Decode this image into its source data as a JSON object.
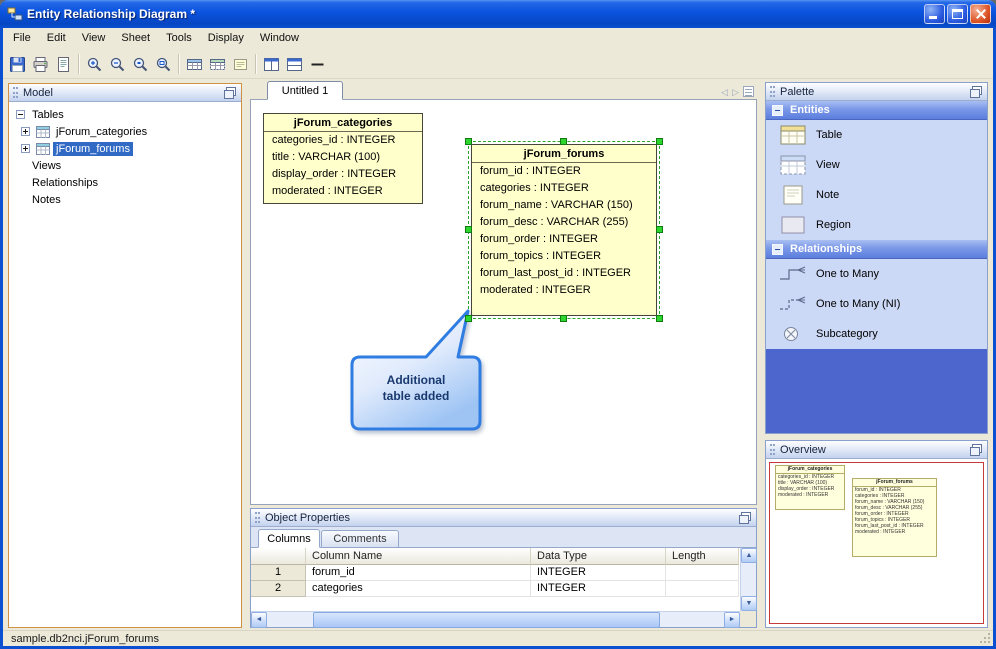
{
  "window": {
    "title": "Entity Relationship Diagram *"
  },
  "menu": {
    "items": [
      "File",
      "Edit",
      "View",
      "Sheet",
      "Tools",
      "Display",
      "Window"
    ]
  },
  "toolbar": {
    "buttons": [
      "save",
      "print",
      "print-preview",
      "zoom-in",
      "zoom-out",
      "zoom-actual-size",
      "zoom-fit",
      "add-table",
      "add-view",
      "add-note",
      "split-horizontal",
      "split-vertical",
      "draw-line"
    ]
  },
  "icons": {
    "arrow_up": "▲",
    "arrow_down": "▼",
    "arrow_left": "◄",
    "arrow_right": "►",
    "tab_prev": "◁",
    "tab_next": "▷"
  },
  "model_panel": {
    "title": "Model",
    "items": [
      {
        "label": "Tables",
        "level": 0,
        "expanded": true
      },
      {
        "label": "jForum_categories",
        "level": 1,
        "icon": "table-icon"
      },
      {
        "label": "jForum_forums",
        "level": 1,
        "icon": "table-icon",
        "selected": true
      },
      {
        "label": "Views",
        "level": 0
      },
      {
        "label": "Relationships",
        "level": 0
      },
      {
        "label": "Notes",
        "level": 0
      }
    ]
  },
  "canvas": {
    "tab_label": "Untitled 1",
    "tables": [
      {
        "name": "jForum_categories",
        "columns": [
          "categories_id : INTEGER",
          "title : VARCHAR (100)",
          "display_order : INTEGER",
          "moderated : INTEGER"
        ]
      },
      {
        "name": "jForum_forums",
        "selected": true,
        "columns": [
          "forum_id : INTEGER",
          "categories : INTEGER",
          "forum_name : VARCHAR (150)",
          "forum_desc : VARCHAR (255)",
          "forum_order : INTEGER",
          "forum_topics : INTEGER",
          "forum_last_post_id : INTEGER",
          "moderated : INTEGER"
        ]
      }
    ],
    "callout": {
      "line1": "Additional",
      "line2": "table added"
    }
  },
  "object_properties": {
    "title": "Object Properties",
    "tabs": [
      "Columns",
      "Comments"
    ],
    "active_tab": "Columns",
    "grid": {
      "headers": [
        "Column Name",
        "Data Type",
        "Length"
      ],
      "rows": [
        {
          "num": "1",
          "column_name": "forum_id",
          "data_type": "INTEGER",
          "length": ""
        },
        {
          "num": "2",
          "column_name": "categories",
          "data_type": "INTEGER",
          "length": ""
        }
      ]
    }
  },
  "palette": {
    "title": "Palette",
    "sections": [
      {
        "title": "Entities",
        "items": [
          {
            "label": "Table",
            "icon": "table-icon"
          },
          {
            "label": "View",
            "icon": "view-icon"
          },
          {
            "label": "Note",
            "icon": "note-icon"
          },
          {
            "label": "Region",
            "icon": "region-icon"
          }
        ]
      },
      {
        "title": "Relationships",
        "items": [
          {
            "label": "One to Many",
            "icon": "one-to-many-icon"
          },
          {
            "label": "One to Many (NI)",
            "icon": "one-to-many-ni-icon"
          },
          {
            "label": "Subcategory",
            "icon": "subcategory-icon"
          }
        ]
      }
    ]
  },
  "overview_panel": {
    "title": "Overview"
  },
  "status_bar": {
    "text": "sample.db2nci.jForum_forums"
  },
  "colors": {
    "titlebar_blue": "#0b54df",
    "selection_blue": "#316ac5",
    "entity_fill": "#ffffcc",
    "handle_green": "#2ed52e",
    "palette_header_blue": "#5b7ede",
    "palette_filler_blue": "#4d66cd",
    "overview_outline_red": "#c63a3a",
    "focus_border_orange": "#cf9245"
  }
}
